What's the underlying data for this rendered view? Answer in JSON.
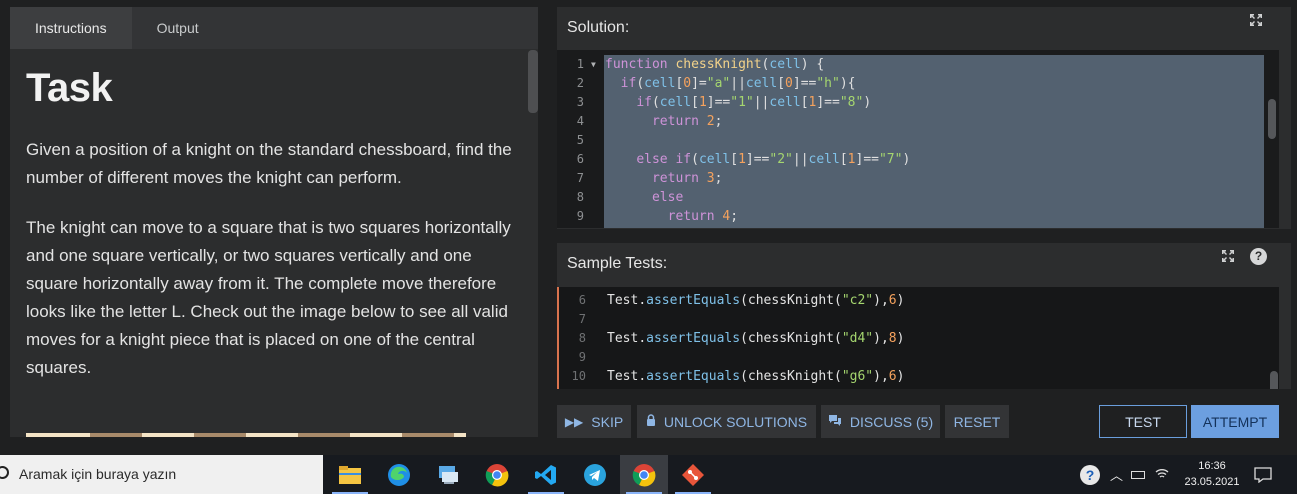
{
  "tabs": {
    "instructions": "Instructions",
    "output": "Output"
  },
  "instructions": {
    "title": "Task",
    "p1": "Given a position of a knight on the standard chessboard, find the number of different moves the knight can perform.",
    "p2": "The knight can move to a square that is two squares horizontally and one square vertically, or two squares vertically and one square horizontally away from it. The complete move therefore looks like the letter L. Check out the image below to see all valid moves for a knight piece that is placed on one of the central squares."
  },
  "solution": {
    "title": "Solution:",
    "line_numbers": [
      "1",
      "2",
      "3",
      "4",
      "5",
      "6",
      "7",
      "8",
      "9"
    ]
  },
  "sample_tests": {
    "title": "Sample Tests:",
    "help": "?",
    "line_numbers": [
      "6",
      "7",
      "8",
      "9",
      "10"
    ],
    "tests": [
      {
        "obj": "Test",
        "method": "assertEquals",
        "fn": "chessKnight",
        "arg": "\"c2\"",
        "expected": "6"
      },
      {
        "obj": "Test",
        "method": "assertEquals",
        "fn": "chessKnight",
        "arg": "\"d4\"",
        "expected": "8"
      },
      {
        "obj": "Test",
        "method": "assertEquals",
        "fn": "chessKnight",
        "arg": "\"g6\"",
        "expected": "6"
      }
    ]
  },
  "actions": {
    "skip": "SKIP",
    "unlock": "UNLOCK SOLUTIONS",
    "discuss": "DISCUSS (5)",
    "reset": "RESET",
    "test": "TEST",
    "attempt": "ATTEMPT"
  },
  "taskbar": {
    "search_placeholder": "Aramak için buraya yazın",
    "time": "16:36",
    "date": "23.05.2021"
  },
  "colors": {
    "accent": "#6c9fe0",
    "test_border": "#d9734e",
    "selection": "#536170"
  }
}
